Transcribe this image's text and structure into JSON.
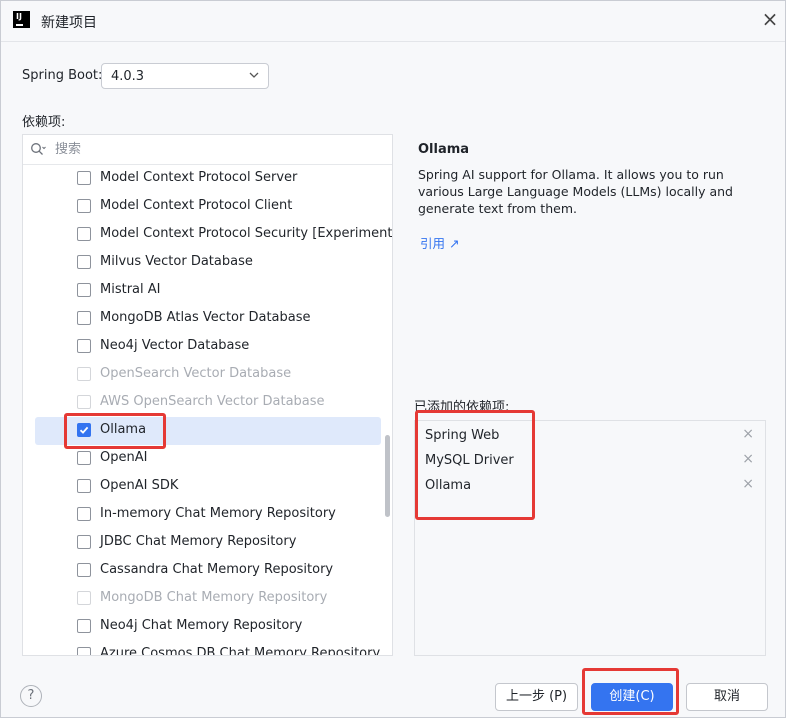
{
  "window": {
    "title": "新建项目",
    "app_icon_text": "IJ"
  },
  "spring_boot": {
    "label": "Spring Boot:",
    "selected_version": "4.0.3"
  },
  "dependencies": {
    "label": "依赖项:",
    "search_placeholder": "搜索",
    "items": [
      {
        "label": "Model Context Protocol Server",
        "checked": false,
        "disabled": false
      },
      {
        "label": "Model Context Protocol Client",
        "checked": false,
        "disabled": false
      },
      {
        "label": "Model Context Protocol Security [Experimental]",
        "checked": false,
        "disabled": false
      },
      {
        "label": "Milvus Vector Database",
        "checked": false,
        "disabled": false
      },
      {
        "label": "Mistral AI",
        "checked": false,
        "disabled": false
      },
      {
        "label": "MongoDB Atlas Vector Database",
        "checked": false,
        "disabled": false
      },
      {
        "label": "Neo4j Vector Database",
        "checked": false,
        "disabled": false
      },
      {
        "label": "OpenSearch Vector Database",
        "checked": false,
        "disabled": true
      },
      {
        "label": "AWS OpenSearch Vector Database",
        "checked": false,
        "disabled": true
      },
      {
        "label": "Ollama",
        "checked": true,
        "disabled": false,
        "selected": true
      },
      {
        "label": "OpenAI",
        "checked": false,
        "disabled": false
      },
      {
        "label": "OpenAI SDK",
        "checked": false,
        "disabled": false
      },
      {
        "label": "In-memory Chat Memory Repository",
        "checked": false,
        "disabled": false
      },
      {
        "label": "JDBC Chat Memory Repository",
        "checked": false,
        "disabled": false
      },
      {
        "label": "Cassandra Chat Memory Repository",
        "checked": false,
        "disabled": false
      },
      {
        "label": "MongoDB Chat Memory Repository",
        "checked": false,
        "disabled": true
      },
      {
        "label": "Neo4j Chat Memory Repository",
        "checked": false,
        "disabled": false
      },
      {
        "label": "Azure Cosmos DB Chat Memory Repository",
        "checked": false,
        "disabled": false
      }
    ]
  },
  "detail": {
    "title": "Ollama",
    "description": "Spring AI support for Ollama. It allows you to run various Large Language Models (LLMs) locally and generate text from them.",
    "reference_link": "引用 ↗"
  },
  "added": {
    "label": "已添加的依赖项:",
    "items": [
      "Spring Web",
      "MySQL Driver",
      "Ollama"
    ],
    "remove_glyph": "×"
  },
  "footer": {
    "help": "?",
    "prev_button": "上一步 (P)",
    "create_button": "创建(C)",
    "cancel_button": "取消"
  },
  "colors": {
    "accent": "#3474f0",
    "highlight": "#e53935",
    "selected_row": "#dfe9fb"
  }
}
